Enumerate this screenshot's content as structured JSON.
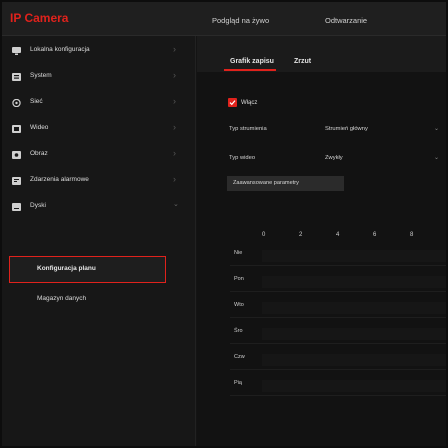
{
  "app": {
    "brand": "IP Camera",
    "top_tabs": [
      "Podgląd na żywo",
      "Odtwarzanie"
    ]
  },
  "sidebar": {
    "items": [
      {
        "label": "Lokalna konfiguracja",
        "icon": "monitor-icon"
      },
      {
        "label": "System",
        "icon": "system-icon"
      },
      {
        "label": "Sieć",
        "icon": "network-icon"
      },
      {
        "label": "Wideo",
        "icon": "video-icon"
      },
      {
        "label": "Obraz",
        "icon": "image-icon"
      },
      {
        "label": "Zdarzenia alarmowe",
        "icon": "alarm-icon"
      },
      {
        "label": "Dyski",
        "icon": "disk-icon"
      }
    ],
    "sub_items": [
      {
        "label": "Konfiguracja planu",
        "active": true
      },
      {
        "label": "Magazyn danych",
        "active": false
      }
    ]
  },
  "main": {
    "tabs": [
      "Grafik zapisu",
      "Zrzut"
    ],
    "enable_label": "Włącz",
    "enable_checked": true,
    "stream_type": {
      "label": "Typ strumienia",
      "value": "Strumień główny"
    },
    "video_type": {
      "label": "Typ wideo",
      "value": "Zwykły"
    },
    "advanced_label": "Zaawansowane parametry",
    "hours": [
      "0",
      "2",
      "4",
      "6",
      "8"
    ],
    "days": [
      "Nie",
      "Pon",
      "Wto",
      "Śro",
      "Czw",
      "Pią"
    ]
  },
  "colors": {
    "accent": "#e0221c",
    "background": "#141414",
    "sidebar": "#171717",
    "topbar": "#1f1f1f"
  }
}
